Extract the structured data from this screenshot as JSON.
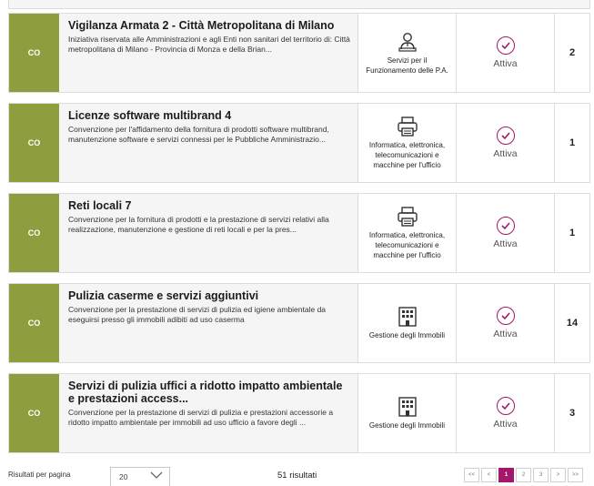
{
  "colors": {
    "accent": "#a3186b",
    "code_bg": "#8e9e3e",
    "card_bg": "#f5f5f5"
  },
  "cards": [
    {
      "code": "CO",
      "title": "Vigilanza Armata 2 - Città Metropolitana di Milano",
      "description": "Iniziativa riservata alle Amministrazioni e agli Enti non sanitari del territorio di: Città metropolitana di Milano - Provincia di Monza e della Brian...",
      "category_icon": "person-desk-icon",
      "category": "Servizi per il Funzionamento delle P.A.",
      "status": "Attiva",
      "count": "2"
    },
    {
      "code": "CO",
      "title": "Licenze software multibrand 4",
      "description": "Convenzione per l'affidamento della fornitura di prodotti software multibrand, manutenzione software e servizi connessi per le Pubbliche Amministrazio...",
      "category_icon": "printer-icon",
      "category": "Informatica, elettronica, telecomunicazioni e macchine per l'ufficio",
      "status": "Attiva",
      "count": "1"
    },
    {
      "code": "CO",
      "title": "Reti locali 7",
      "description": "Convenzione per la fornitura di prodotti e la prestazione di servizi relativi alla realizzazione, manutenzione e gestione di reti locali e per la pres...",
      "category_icon": "printer-icon",
      "category": "Informatica, elettronica, telecomunicazioni e macchine per l'ufficio",
      "status": "Attiva",
      "count": "1"
    },
    {
      "code": "CO",
      "title": "Pulizia caserme e servizi aggiuntivi",
      "description": "Convenzione per la prestazione di servizi di pulizia ed igiene ambientale da eseguirsi presso gli immobili adibiti ad uso caserma",
      "category_icon": "building-icon",
      "category": "Gestione degli Immobili",
      "status": "Attiva",
      "count": "14"
    },
    {
      "code": "CO",
      "title": "Servizi di pulizia uffici a ridotto impatto ambientale e prestazioni access...",
      "description": "Convenzione per la prestazione di servizi di pulizia e prestazioni accessorie a ridotto impatto ambientale per immobili ad uso ufficio a favore degli ...",
      "category_icon": "building-icon",
      "category": "Gestione degli Immobili",
      "status": "Attiva",
      "count": "3"
    }
  ],
  "footer": {
    "rpp_label": "Risultati per pagina",
    "rpp_value": "20",
    "results": "51 risultati",
    "pager": [
      "<<",
      "<",
      "1",
      "2",
      "3",
      ">",
      ">>"
    ],
    "current_page": "1"
  }
}
